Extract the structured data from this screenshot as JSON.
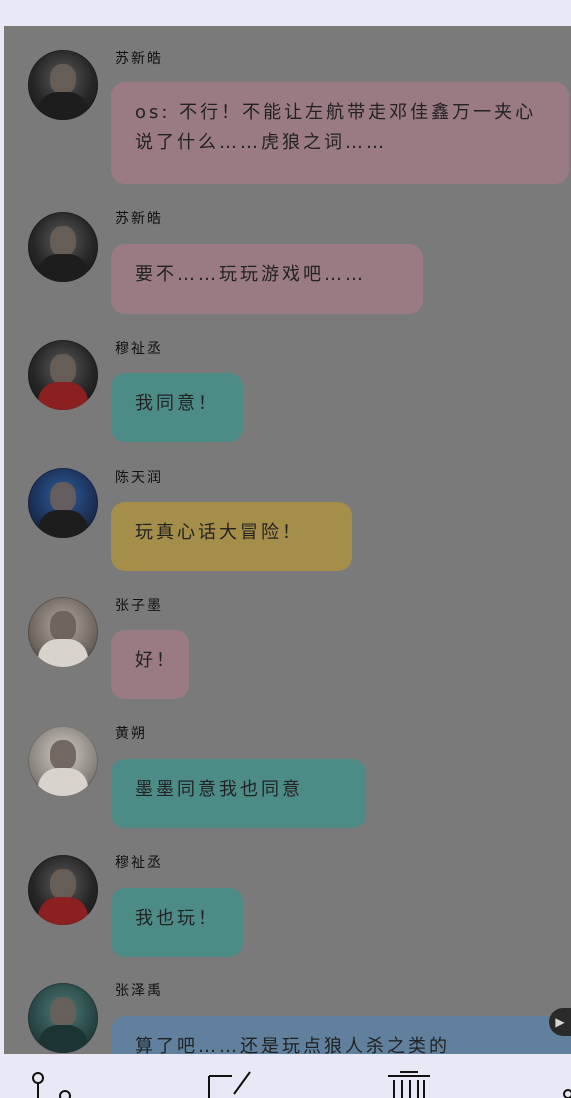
{
  "chat": {
    "messages": [
      {
        "sender": "苏新皓",
        "text": "os: 不行！不能让左航带走邓佳鑫万一夹心说了什么……虎狼之词……",
        "color": "#9a7b83",
        "avatar": "dark-hood-avatar"
      },
      {
        "sender": "苏新皓",
        "text": "要不……玩玩游戏吧……",
        "color": "#9a7b83",
        "avatar": "dark-hood-avatar"
      },
      {
        "sender": "穆祉丞",
        "text": "我同意！",
        "color": "#4d8b87",
        "avatar": "red-outfit-avatar"
      },
      {
        "sender": "陈天润",
        "text": "玩真心话大冒险！",
        "color": "#a58d4a",
        "avatar": "blue-stage-avatar"
      },
      {
        "sender": "张子墨",
        "text": "好！",
        "color": "#9a7b83",
        "avatar": "grey-jacket-avatar"
      },
      {
        "sender": "黄朔",
        "text": "墨墨同意我也同意",
        "color": "#4d8b87",
        "avatar": "white-outfit-avatar"
      },
      {
        "sender": "穆祉丞",
        "text": "我也玩！",
        "color": "#4d8b87",
        "avatar": "red-outfit-avatar"
      },
      {
        "sender": "张泽禹",
        "text": "算了吧……还是玩点狼人杀之类的",
        "color": "#60809e",
        "avatar": "teal-avatar"
      }
    ]
  },
  "toolbar": {
    "icons": [
      "branch-icon",
      "edit-icon",
      "trash-icon",
      "share-icon"
    ]
  }
}
